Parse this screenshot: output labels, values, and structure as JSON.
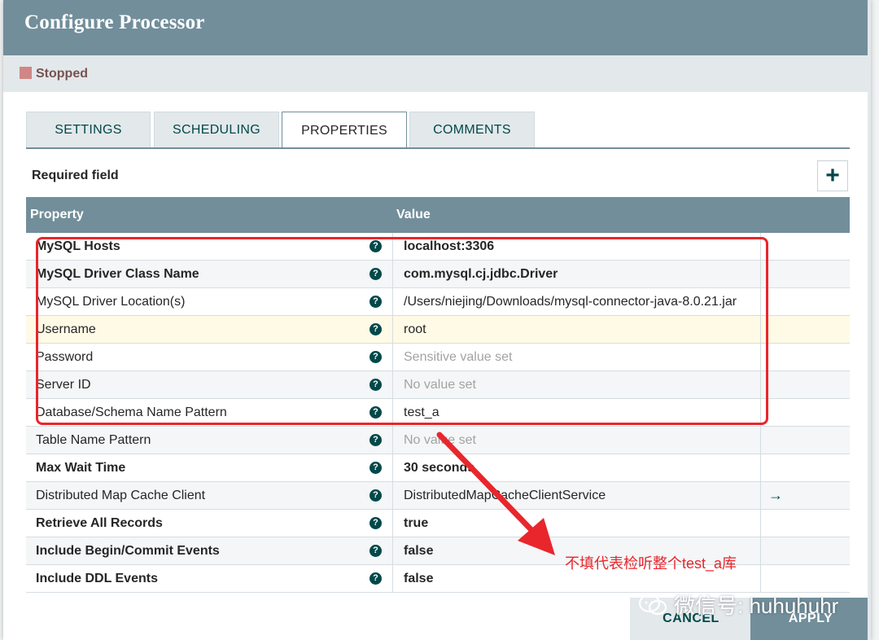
{
  "dialog": {
    "title": "Configure Processor",
    "status": "Stopped"
  },
  "tabs": [
    {
      "label": "SETTINGS"
    },
    {
      "label": "SCHEDULING"
    },
    {
      "label": "PROPERTIES",
      "active": true
    },
    {
      "label": "COMMENTS"
    }
  ],
  "properties_panel": {
    "required_label": "Required field",
    "add_button": "+",
    "headers": {
      "property": "Property",
      "value": "Value"
    },
    "help_glyph": "?",
    "rows": [
      {
        "name": "MySQL Hosts",
        "value": "localhost:3306"
      },
      {
        "name": "MySQL Driver Class Name",
        "value": "com.mysql.cj.jdbc.Driver"
      },
      {
        "name": "MySQL Driver Location(s)",
        "value": "/Users/niejing/Downloads/mysql-connector-java-8.0.21.jar"
      },
      {
        "name": "Username",
        "value": "root"
      },
      {
        "name": "Password",
        "value": "Sensitive value set"
      },
      {
        "name": "Server ID",
        "value": "No value set"
      },
      {
        "name": "Database/Schema Name Pattern",
        "value": "test_a"
      },
      {
        "name": "Table Name Pattern",
        "value": "No value set"
      },
      {
        "name": "Max Wait Time",
        "value": "30 seconds"
      },
      {
        "name": "Distributed Map Cache Client",
        "value": "DistributedMapCacheClientService",
        "goto": "→"
      },
      {
        "name": "Retrieve All Records",
        "value": "true"
      },
      {
        "name": "Include Begin/Commit Events",
        "value": "false"
      },
      {
        "name": "Include DDL Events",
        "value": "false"
      }
    ]
  },
  "annotation": "不填代表检听整个test_a库",
  "footer": {
    "cancel": "CANCEL",
    "apply": "APPLY"
  },
  "watermark": "微信号: huhuhuhr",
  "colors": {
    "header": "#728e9b",
    "accent": "#004849",
    "highlight": "#e8262c",
    "stopped": "#d18686"
  }
}
